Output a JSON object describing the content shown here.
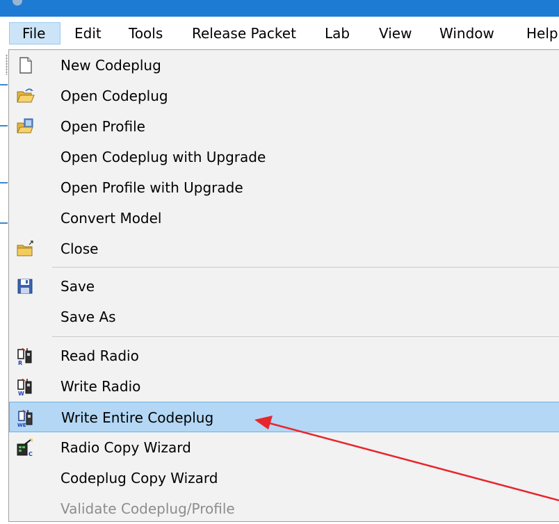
{
  "menubar": {
    "items": [
      {
        "label": "File"
      },
      {
        "label": "Edit"
      },
      {
        "label": "Tools"
      },
      {
        "label": "Release Packet"
      },
      {
        "label": "Lab"
      },
      {
        "label": "View"
      },
      {
        "label": "Window"
      },
      {
        "label": "Help"
      }
    ],
    "active_item": "File"
  },
  "file_menu": {
    "items": [
      {
        "label": "New Codeplug",
        "icon": "new-document-icon"
      },
      {
        "label": "Open Codeplug",
        "icon": "open-folder-icon"
      },
      {
        "label": "Open Profile",
        "icon": "open-profile-icon"
      },
      {
        "label": "Open Codeplug with Upgrade",
        "icon": ""
      },
      {
        "label": "Open Profile with Upgrade",
        "icon": ""
      },
      {
        "label": "Convert Model",
        "icon": ""
      },
      {
        "label": "Close",
        "icon": "close-folder-icon"
      },
      {
        "label": "Save",
        "icon": "floppy-disk-icon"
      },
      {
        "label": "Save As",
        "icon": ""
      },
      {
        "label": "Read Radio",
        "icon": "read-radio-icon"
      },
      {
        "label": "Write Radio",
        "icon": "write-radio-icon"
      },
      {
        "label": "Write Entire Codeplug",
        "icon": "write-entire-codeplug-icon"
      },
      {
        "label": "Radio Copy Wizard",
        "icon": "radio-copy-wizard-icon"
      },
      {
        "label": "Codeplug Copy Wizard",
        "icon": ""
      },
      {
        "label": "Validate Codeplug/Profile",
        "icon": ""
      }
    ],
    "highlighted_item": "Write Entire Codeplug",
    "disabled_item": "Validate Codeplug/Profile"
  },
  "colors": {
    "title_bar": "#1e7bd4",
    "menu_background": "#f2f2f2",
    "highlight": "#b3d7f4",
    "annotation_arrow": "#e8262d"
  }
}
